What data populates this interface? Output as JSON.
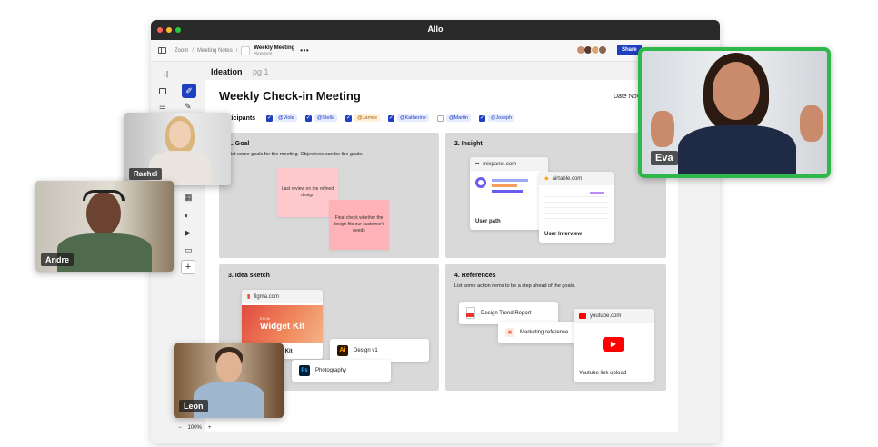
{
  "app": {
    "title": "Allo"
  },
  "colors": {
    "accent": "#1e3fbf",
    "eva_border": "#2fb84a",
    "titlebar": "#2a2a2a"
  },
  "breadcrumb": {
    "root": "Zoom",
    "sep": "/",
    "parent": "Meeting Notes",
    "current": "Weekly Meeting",
    "current_sub": "Alignment",
    "more": "•••"
  },
  "share_label": "Share",
  "document": {
    "tab_active": "Ideation",
    "tab_page": "pg 1",
    "title": "Weekly Check-in Meeting",
    "date_label": "Date Nov"
  },
  "participants": {
    "label": "Participants",
    "items": [
      {
        "name": "@Viola",
        "checked": true
      },
      {
        "name": "@Stella",
        "checked": true
      },
      {
        "name": "@James",
        "checked": true
      },
      {
        "name": "@Katherine",
        "checked": true
      },
      {
        "name": "@Martin",
        "checked": false
      },
      {
        "name": "@Joseph",
        "checked": true
      }
    ]
  },
  "sections": {
    "goal": {
      "title": "1. Goal",
      "desc": "List some goals for the meeting. Objectives can be the goals.",
      "sticky1": "Last review on the refined design",
      "sticky2": "Final check whether the design fits our customer's needs"
    },
    "insight": {
      "title": "2. Insight",
      "card1_site": "mixpanel.com",
      "card1_caption": "User path",
      "card2_site": "airtable.com",
      "card2_caption": "User Interview"
    },
    "idea": {
      "title": "3. Idea sketch",
      "figma_site": "figma.com",
      "figma_small": "ESI M",
      "figma_big": "Widget Kit",
      "figma_caption": "t Kit",
      "design_file": "Design v1",
      "photo_file": "Photography"
    },
    "references": {
      "title": "4. References",
      "desc": "List some action items to be a step ahead of the goals.",
      "report": "Design Trend Report",
      "marketing": "Marketing reference",
      "youtube_site": "youtube.com",
      "youtube_caption": "Youtube link upload"
    }
  },
  "zoom": {
    "minus": "−",
    "value": "100%",
    "plus": "+"
  },
  "videos": {
    "eva": "Eva",
    "rachel": "Rachel",
    "andre": "Andre",
    "leon": "Leon"
  },
  "icons": [
    "dock-right-icon",
    "frame-icon",
    "menu-icon",
    "pen-icon",
    "pencil-icon",
    "table-icon",
    "palette-icon",
    "video-icon",
    "comment-icon",
    "plus-icon",
    "youtube-icon",
    "pdf-icon",
    "figma-icon",
    "illustrator-icon",
    "photoshop-icon"
  ]
}
